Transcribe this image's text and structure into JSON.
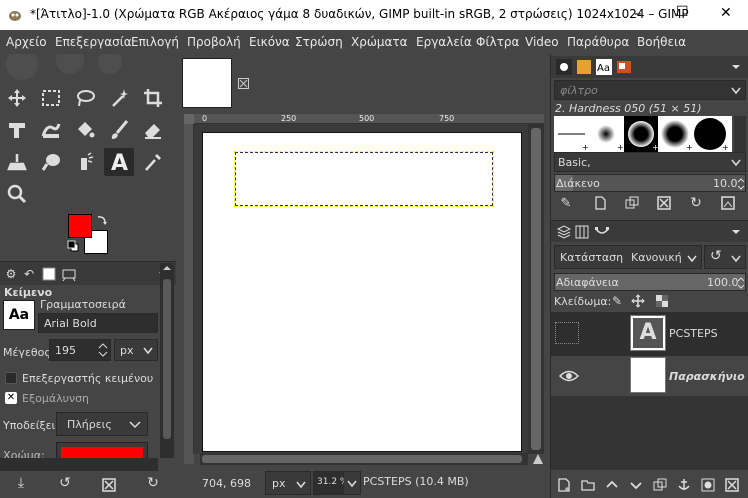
{
  "window": {
    "title": "*[Άτιτλο]-1.0 (Χρώματα RGB Ακέραιος γάμα 8 δυαδικών, GIMP built-in sRGB, 2 στρώσεις) 1024x1024 – GIMP",
    "minimize": "–",
    "maximize": "☐",
    "close": "✕"
  },
  "menu": [
    "Αρχείο",
    "Επεξεργασία",
    "Επιλογή",
    "Προβολή",
    "Εικόνα",
    "Στρώση",
    "Χρώματα",
    "Εργαλεία",
    "Φίλτρα",
    "Video",
    "Παράθυρα",
    "Βοήθεια"
  ],
  "colors": {
    "foreground": "#ff0000",
    "background": "#ffffff",
    "accent": "#e0e0e0"
  },
  "tool_options": {
    "title": "Κείμενο",
    "font_label": "Γραμματοσειρά",
    "font_icon_text": "Aa",
    "font_value": "Arial Bold",
    "size_label": "Μέγεθος:",
    "size_value": "195",
    "size_unit": "px",
    "editor_checkbox": "Επεξεργαστής κειμένου",
    "antialias_checkbox": "Εξομάλυνση",
    "hinting_label": "Υποδείξεις:",
    "hinting_value": "Πλήρεις",
    "color_label": "Χρώμα:"
  },
  "canvas": {
    "ruler_ticks": [
      "0",
      "250",
      "500",
      "750"
    ],
    "coords": "704, 698",
    "coord_unit": "px",
    "zoom": "31.2 %",
    "status": "PCSTEPS (10.4 MB)"
  },
  "brushes": {
    "filter_placeholder": "φίλτρο",
    "selected_brush": "2. Hardness 050 (51 × 51)",
    "preset": "Basic,",
    "spacing_label": "Διάκενο",
    "spacing_value": "10.0"
  },
  "layers": {
    "mode_label": "Κατάσταση",
    "mode_value": "Κανονική",
    "opacity_label": "Αδιαφάνεια",
    "opacity_value": "100.0",
    "lock_label": "Κλείδωμα:",
    "items": [
      {
        "name": "PCSTEPS",
        "thumb_text": "A",
        "visible": false
      },
      {
        "name": "Παρασκήνιο",
        "visible": true
      }
    ]
  }
}
